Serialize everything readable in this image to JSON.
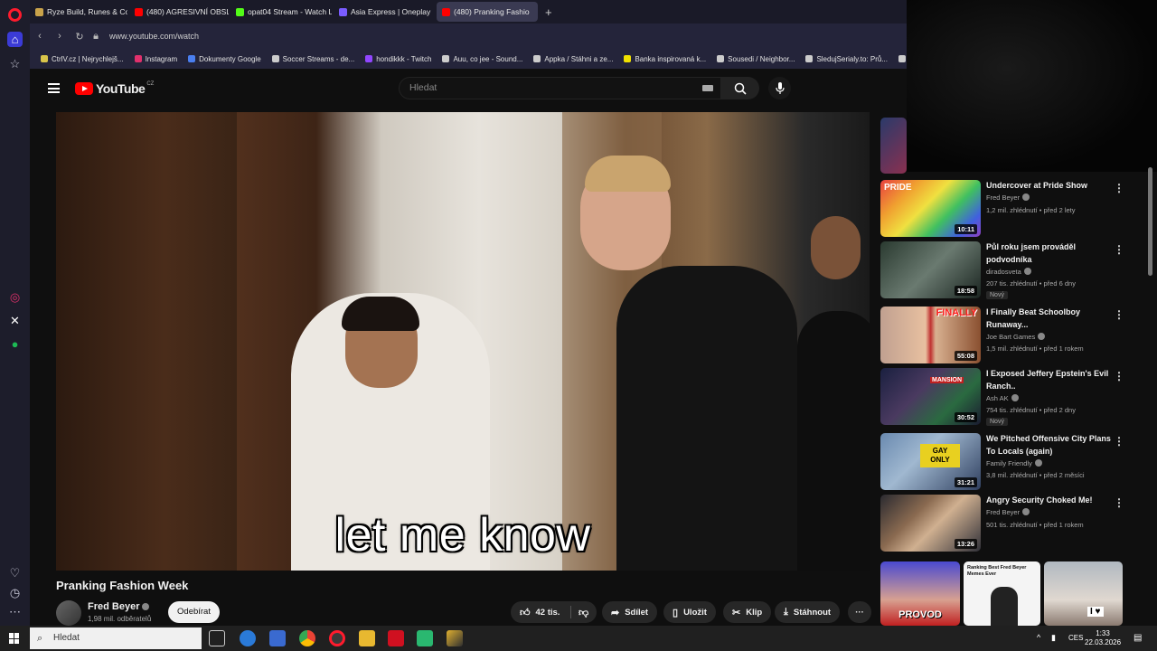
{
  "browser": {
    "tabs": [
      {
        "label": "Ryze Build, Runes & Coun",
        "color": "#c8a24a"
      },
      {
        "label": "(480) AGRESIVNÍ OBSLUH",
        "color": "#ff0000"
      },
      {
        "label": "opat04 Stream - Watch Li",
        "color": "#53fc18"
      },
      {
        "label": "Asia Express | Oneplay",
        "color": "#7a5cff"
      },
      {
        "label": "(480) Pranking Fashio",
        "color": "#ff0000",
        "active": true
      }
    ],
    "new_tab": "+",
    "url": "www.youtube.com/watch",
    "bookmarks": [
      {
        "label": "CtrlV.cz | Nejrychlejš...",
        "color": "#d8c44a"
      },
      {
        "label": "Instagram",
        "color": "#e1306c"
      },
      {
        "label": "Dokumenty Google",
        "color": "#4a7ff0"
      },
      {
        "label": "Soccer Streams - de...",
        "color": "#dddddd"
      },
      {
        "label": "hondikkk - Twitch",
        "color": "#9146ff"
      },
      {
        "label": "Auu, co jee - Sound...",
        "color": "#dddddd"
      },
      {
        "label": "Appka / Stáhni a ze...",
        "color": "#dddddd"
      },
      {
        "label": "Banka inspirovaná k...",
        "color": "#f0e000"
      },
      {
        "label": "Sousedi / Neighbor...",
        "color": "#dddddd"
      },
      {
        "label": "SledujSerialy.to: Prů...",
        "color": "#dddddd"
      },
      {
        "label": "Ne",
        "color": "#dddddd"
      }
    ]
  },
  "youtube": {
    "logo_text": "YouTube",
    "region": "CZ",
    "search_placeholder": "Hledat"
  },
  "video": {
    "caption": "let me know",
    "title": "Pranking Fashion Week",
    "channel": "Fred Beyer",
    "subscribers": "1,98 mil. odběratelů",
    "subscribe_label": "Odebírat",
    "likes": "42 tis.",
    "share_label": "Sdílet",
    "save_label": "Uložit",
    "clip_label": "Klip",
    "download_label": "Stáhnout",
    "more_label": "···"
  },
  "recommendations": [
    {
      "title": "Undercover at Pride Show",
      "channel": "Fred Beyer",
      "meta": "1,2 mil. zhlédnutí • před 2 lety",
      "duration": "10:11",
      "thumb_text": "PRIDE",
      "new": ""
    },
    {
      "title": "Půl roku jsem prováděl podvodníka",
      "channel": "diradosveta",
      "meta": "207 tis. zhlédnutí • před 6 dny",
      "duration": "18:58",
      "thumb_text": "",
      "new": "Nový"
    },
    {
      "title": "I Finally Beat Schoolboy Runaway...",
      "channel": "Joe Bart Games",
      "meta": "1,5 mil. zhlédnutí • před 1 rokem",
      "duration": "55:08",
      "thumb_text": "FINALLY",
      "new": ""
    },
    {
      "title": "I Exposed Jeffery Epstein's Evil Ranch..",
      "channel": "Ash AK",
      "meta": "754 tis. zhlédnutí • před 2 dny",
      "duration": "30:52",
      "thumb_text": "MANSION",
      "new": "Nový"
    },
    {
      "title": "We Pitched Offensive City Plans To Locals (again)",
      "channel": "Family Friendly",
      "meta": "3,8 mil. zhlédnutí • před 2 měsíci",
      "duration": "31:21",
      "thumb_text": "GAY ONLY",
      "new": ""
    },
    {
      "title": "Angry Security Choked Me!",
      "channel": "Fred Beyer",
      "meta": "501 tis. zhlédnutí • před 1 rokem",
      "duration": "13:26",
      "thumb_text": "",
      "new": ""
    }
  ],
  "shorts": [
    {
      "text": "PROVOD"
    },
    {
      "text": "Ranking Best Fred Beyer Memes Ever"
    },
    {
      "text": "I ♥"
    }
  ],
  "taskbar": {
    "search_placeholder": "Hledat",
    "language": "CES",
    "time": "1:33",
    "date": "22.03.2026"
  }
}
